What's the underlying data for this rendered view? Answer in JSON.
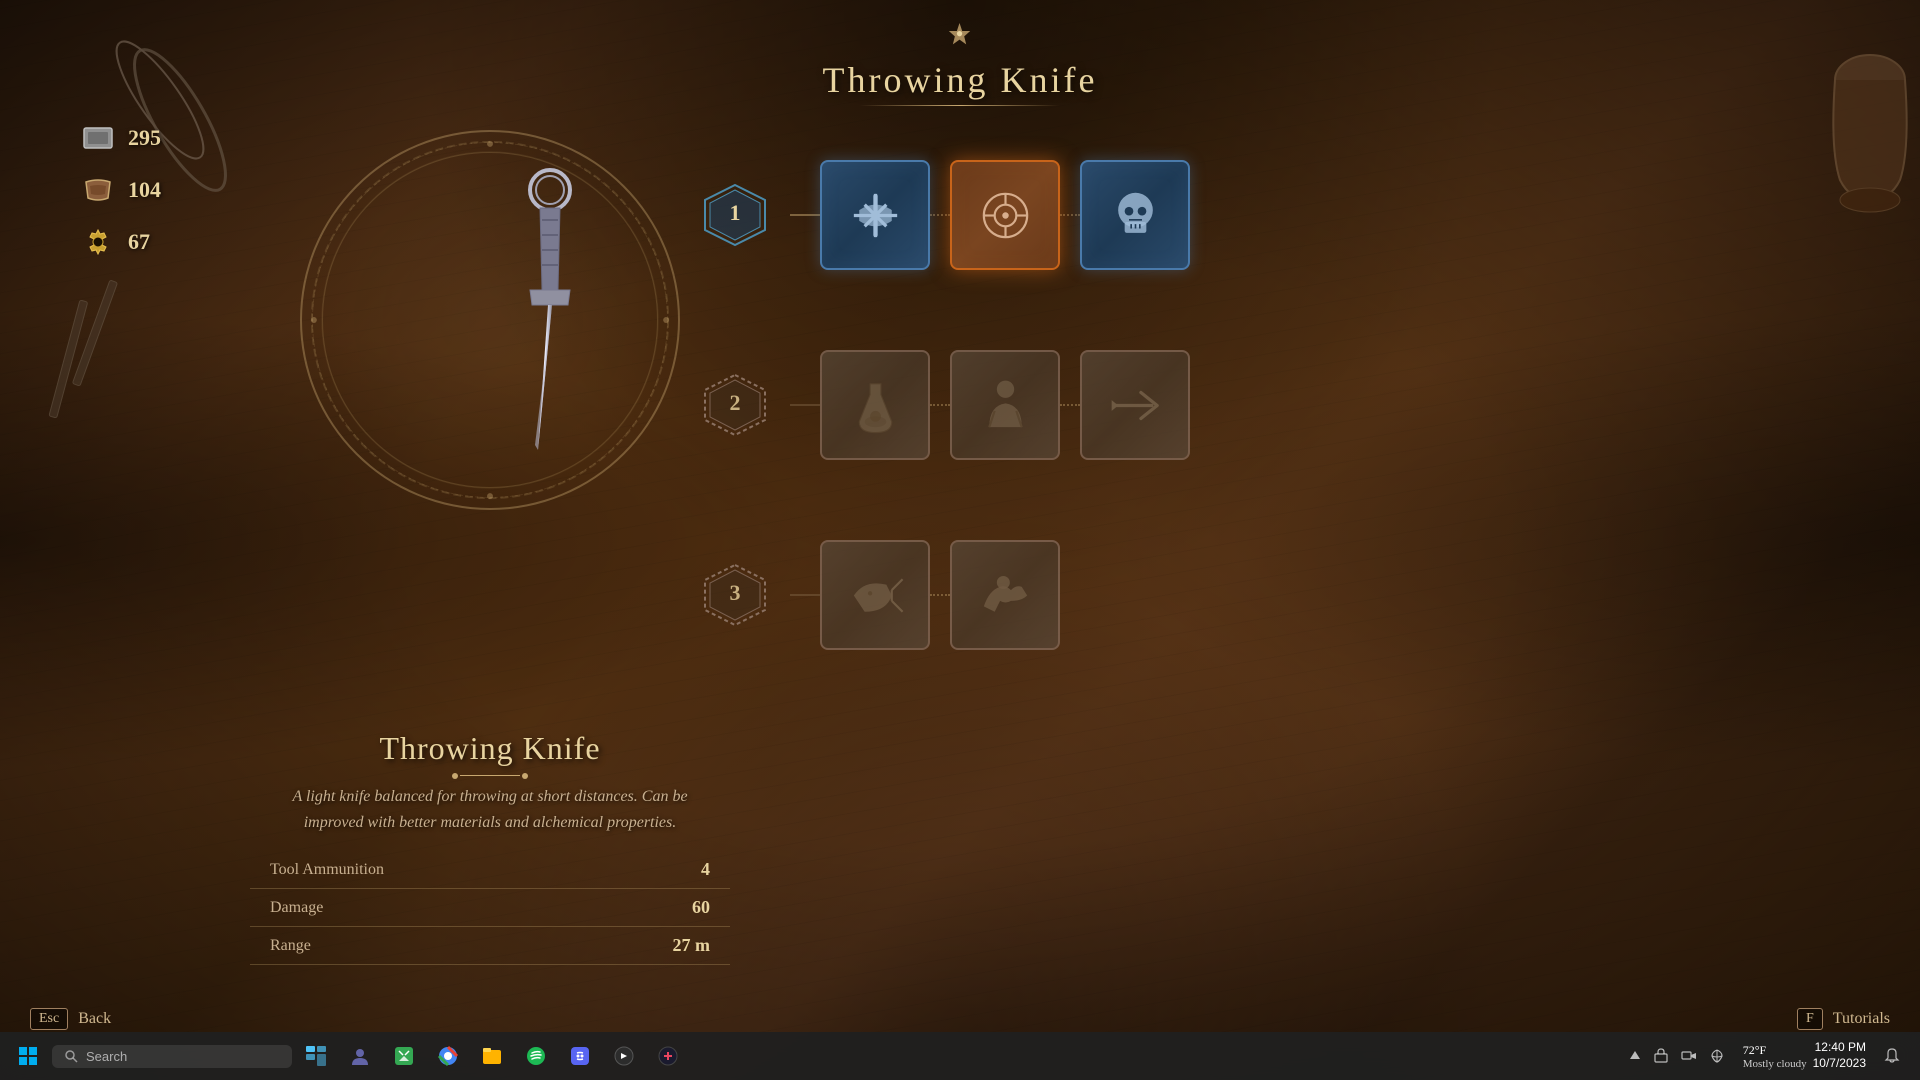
{
  "title": {
    "text": "Throwing Knife",
    "ornament": "◆"
  },
  "resources": [
    {
      "id": "silver",
      "count": "295",
      "icon": "silver-icon"
    },
    {
      "id": "leather",
      "count": "104",
      "icon": "leather-icon"
    },
    {
      "id": "gear",
      "count": "67",
      "icon": "gear-icon"
    }
  ],
  "item": {
    "name": "Throwing Knife",
    "description": "A light knife balanced for throwing at short distances. Can be improved with better materials and alchemical properties.",
    "stats": [
      {
        "label": "Tool Ammunition",
        "value": "4"
      },
      {
        "label": "Damage",
        "value": "60"
      },
      {
        "label": "Range",
        "value": "27 m"
      }
    ]
  },
  "upgrade_tree": {
    "tiers": [
      {
        "number": "1",
        "nodes": [
          {
            "type": "active",
            "icon": "crossbow-upgrade-icon"
          },
          {
            "type": "selected",
            "icon": "target-upgrade-icon"
          },
          {
            "type": "active",
            "icon": "skull-upgrade-icon"
          }
        ]
      },
      {
        "number": "2",
        "nodes": [
          {
            "type": "locked",
            "icon": "poison-upgrade-icon"
          },
          {
            "type": "locked",
            "icon": "special-upgrade-icon"
          },
          {
            "type": "locked",
            "icon": "arrow-upgrade-icon"
          }
        ]
      },
      {
        "number": "3",
        "nodes": [
          {
            "type": "locked",
            "icon": "fish-upgrade-icon"
          },
          {
            "type": "locked",
            "icon": "animal-upgrade-icon"
          }
        ]
      }
    ]
  },
  "bottom": {
    "back_key": "Esc",
    "back_label": "Back",
    "tutorials_key": "F",
    "tutorials_label": "Tutorials"
  },
  "taskbar": {
    "search_placeholder": "Search",
    "time": "12:40 PM",
    "date": "10/7/2023",
    "weather_temp": "72°F",
    "weather_desc": "Mostly cloudy"
  }
}
